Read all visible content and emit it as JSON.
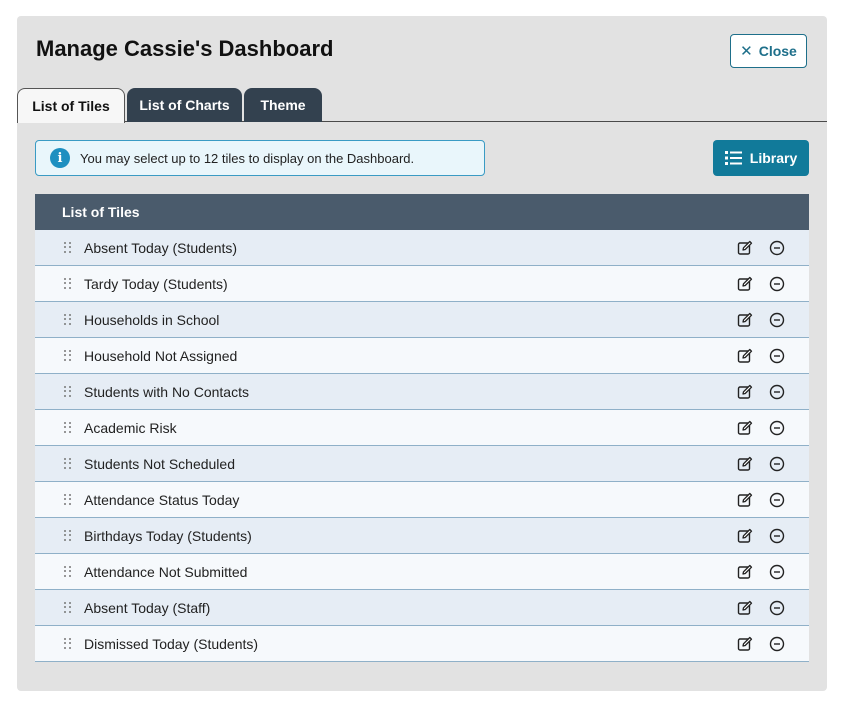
{
  "dialog": {
    "title": "Manage Cassie's Dashboard",
    "close_label": "Close"
  },
  "tabs": [
    {
      "label": "List of Tiles",
      "active": true
    },
    {
      "label": "List of Charts",
      "active": false
    },
    {
      "label": "Theme",
      "active": false
    }
  ],
  "info": {
    "icon": "info-icon",
    "text": "You may select up to 12 tiles to display on the Dashboard."
  },
  "library_label": "Library",
  "table": {
    "header": "List of Tiles",
    "rows": [
      {
        "label": "Absent Today (Students)"
      },
      {
        "label": "Tardy Today (Students)"
      },
      {
        "label": "Households in School"
      },
      {
        "label": "Household Not Assigned"
      },
      {
        "label": "Students with No Contacts"
      },
      {
        "label": "Academic Risk"
      },
      {
        "label": "Students Not Scheduled"
      },
      {
        "label": "Attendance Status Today"
      },
      {
        "label": "Birthdays Today (Students)"
      },
      {
        "label": "Attendance Not Submitted"
      },
      {
        "label": "Absent Today (Staff)"
      },
      {
        "label": "Dismissed Today (Students)"
      }
    ]
  },
  "colors": {
    "accent": "#117a9a",
    "tab_inactive": "#33414f",
    "table_header": "#4a5b6c"
  }
}
